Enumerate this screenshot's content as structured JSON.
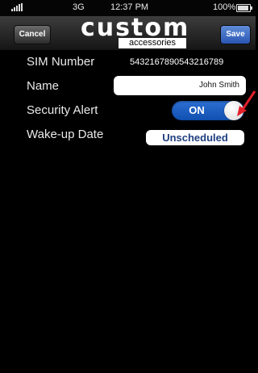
{
  "status_bar": {
    "network": "3G",
    "time": "12:37 PM",
    "battery_percent": "100%"
  },
  "nav": {
    "cancel_label": "Cancel",
    "save_label": "Save",
    "logo_main": "custom",
    "logo_sub": "accessories"
  },
  "form": {
    "sim": {
      "label": "SIM Number",
      "value": "5432167890543216789"
    },
    "name": {
      "label": "Name",
      "value": "John Smith"
    },
    "security_alert": {
      "label": "Security Alert",
      "state": "ON"
    },
    "wakeup": {
      "label": "Wake-up Date",
      "value": "Unscheduled"
    }
  },
  "colors": {
    "save_button": "#2955b3",
    "toggle_on": "#1f5fc3",
    "arrow": "#e0202a"
  }
}
